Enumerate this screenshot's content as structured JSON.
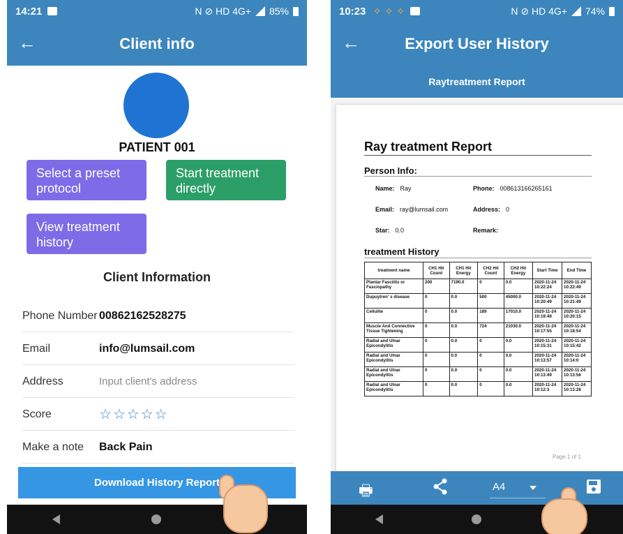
{
  "left": {
    "status": {
      "time": "14:21",
      "icons": "N ⊘ HD 4G+",
      "battery": "85%"
    },
    "appbar": {
      "title": "Client info"
    },
    "patient_name": "PATIENT 001",
    "buttons": {
      "preset": "Select a preset protocol",
      "start": "Start treatment directly",
      "history": "View treatment history"
    },
    "section_title": "Client Information",
    "rows": [
      {
        "label": "Phone Number",
        "value": "00862162528275"
      },
      {
        "label": "Email",
        "value": "info@lumsail.com"
      },
      {
        "label": "Address",
        "placeholder": "Input client's address"
      },
      {
        "label": "Score",
        "stars": 0,
        "max": 5
      },
      {
        "label": "Make a note",
        "value": "Back Pain"
      }
    ],
    "download_button": "Download History Report"
  },
  "right": {
    "status": {
      "time": "10:23",
      "icons": "N ⊘ HD 4G+",
      "battery": "74%"
    },
    "appbar": {
      "title": "Export User History"
    },
    "subtitle": "Raytreatment Report",
    "report": {
      "title": "Ray treatment Report",
      "person_info_title": "Person Info:",
      "person": {
        "name_label": "Name:",
        "name": "Ray",
        "phone_label": "Phone:",
        "phone": "008613166265161",
        "email_label": "Email:",
        "email": "ray@lumsail.com",
        "address_label": "Address:",
        "address": "0",
        "star_label": "Star:",
        "star": "0.0",
        "remark_label": "Remark:",
        "remark": ""
      },
      "history_title": "treatment History",
      "columns": [
        "treatment name",
        "CH1 Hit Count",
        "CH1 Hit Energy",
        "CH2 Hit Count",
        "CH2 Hit Energy",
        "Start Time",
        "End Time"
      ],
      "rows": [
        [
          "Plantar Fasciitis or Fasciopathy",
          "200",
          "7190.0",
          "0",
          "0.0",
          "2020-11-24 10:22:24",
          "2020-11-24 10:22:49"
        ],
        [
          "Dupuytren' s disease",
          "0",
          "0.0",
          "500",
          "45000.0",
          "2020-11-24 10:20:49",
          "2020-11-24 10:21:49"
        ],
        [
          "Cellulite",
          "0",
          "0.0",
          "189",
          "17010.0",
          "2020-11-24 10:19:49",
          "2020-11-24 10:20:15"
        ],
        [
          "Muscle And Connective Tissue Tightening",
          "0",
          "0.0",
          "724",
          "21030.0",
          "2020-11-24 10:17:55",
          "2020-11-24 10:18:54"
        ],
        [
          "Radial and Ulnar Epicondylitis",
          "0",
          "0.0",
          "0",
          "0.0",
          "2020-11-24 10:15:31",
          "2020-11-24 10:15:42"
        ],
        [
          "Radial and Ulnar Epicondylitis",
          "0",
          "0.0",
          "0",
          "0.0",
          "2020-11-24 10:13:57",
          "2020-11-24 10:14:0"
        ],
        [
          "Radial and Ulnar Epicondylitis",
          "0",
          "0.0",
          "0",
          "0.0",
          "2020-11-24 10:13:49",
          "2020-11-24 10:13:56"
        ],
        [
          "Radial and Ulnar Epicondylitis",
          "0",
          "0.0",
          "0",
          "0.0",
          "2020-11-24 10:12:3",
          "2020-11-24 10:13:28"
        ]
      ],
      "page_label": "Page 1 of 1"
    },
    "bottombar": {
      "paper_size": "A4",
      "icons": [
        "print-icon",
        "share-icon",
        "save-icon"
      ]
    }
  },
  "colors": {
    "primary": "#3c86bd",
    "purple": "#7e6be8",
    "green": "#2c9f69",
    "download": "#3596e3",
    "avatar": "#1f73d2"
  }
}
